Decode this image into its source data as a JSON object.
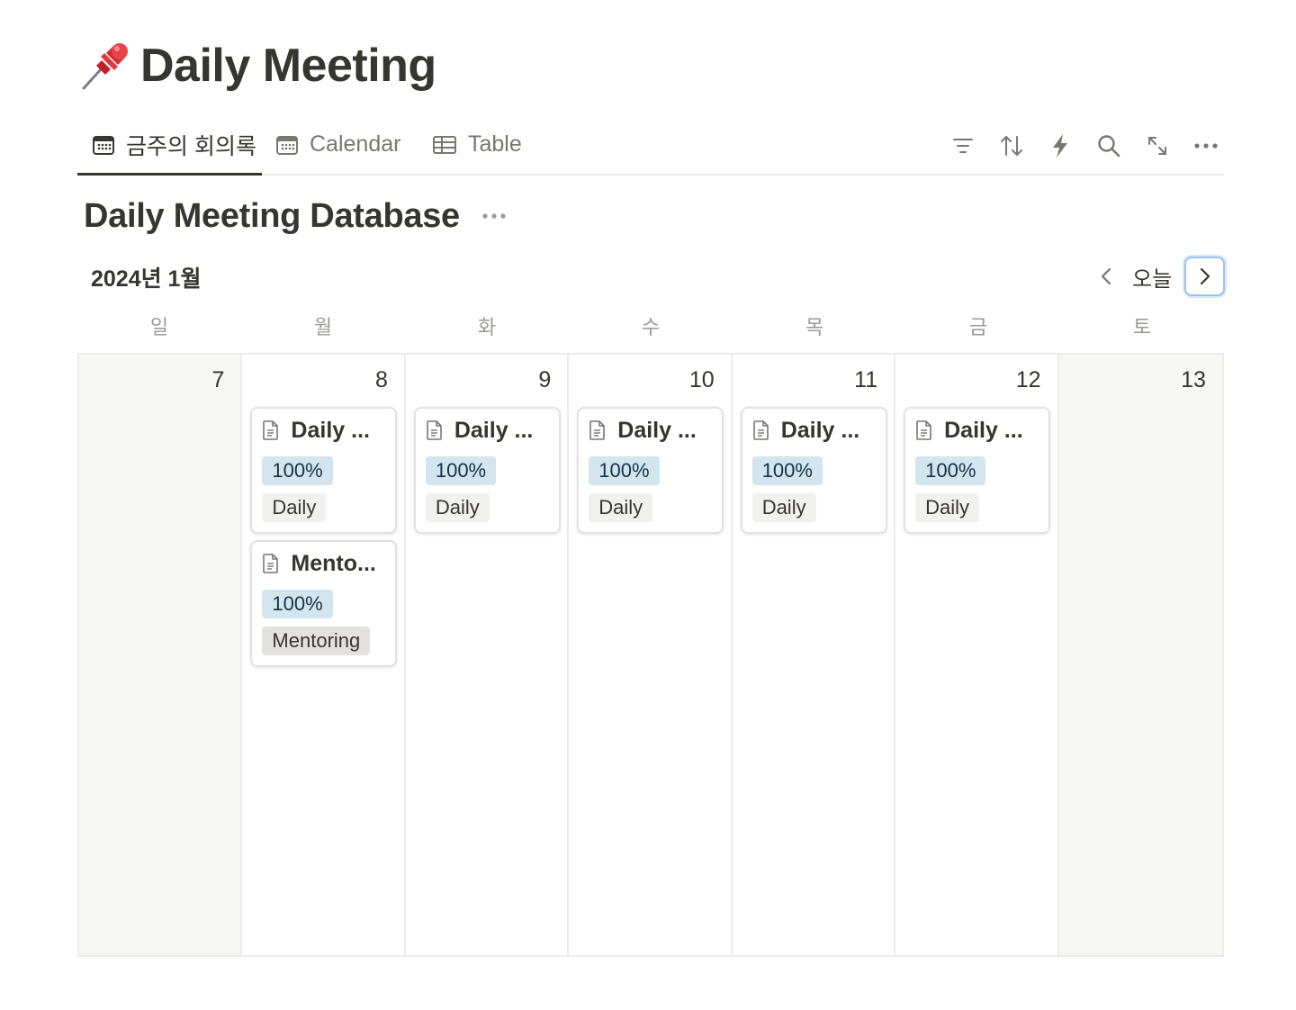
{
  "page": {
    "title": "Daily Meeting",
    "icon": "pushpin-icon"
  },
  "tabs": [
    {
      "label": "금주의 회의록",
      "icon": "calendar-icon",
      "active": true
    },
    {
      "label": "Calendar",
      "icon": "calendar-icon",
      "active": false
    },
    {
      "label": "Table",
      "icon": "table-icon",
      "active": false
    }
  ],
  "toolbar": [
    "filter-icon",
    "sort-icon",
    "automation-icon",
    "search-icon",
    "expand-icon",
    "more-icon"
  ],
  "database": {
    "title": "Daily Meeting Database"
  },
  "calendar": {
    "month_label": "2024년 1월",
    "today_label": "오늘",
    "weekdays": [
      "일",
      "월",
      "화",
      "수",
      "목",
      "금",
      "토"
    ],
    "days": [
      {
        "num": "7",
        "weekend": true,
        "cards": []
      },
      {
        "num": "8",
        "weekend": false,
        "cards": [
          {
            "title": "Daily ...",
            "progress": "100%",
            "tag": "Daily"
          },
          {
            "title": "Mento...",
            "progress": "100%",
            "tag": "Mentoring"
          }
        ]
      },
      {
        "num": "9",
        "weekend": false,
        "cards": [
          {
            "title": "Daily ...",
            "progress": "100%",
            "tag": "Daily"
          }
        ]
      },
      {
        "num": "10",
        "weekend": false,
        "cards": [
          {
            "title": "Daily ...",
            "progress": "100%",
            "tag": "Daily"
          }
        ]
      },
      {
        "num": "11",
        "weekend": false,
        "cards": [
          {
            "title": "Daily ...",
            "progress": "100%",
            "tag": "Daily"
          }
        ]
      },
      {
        "num": "12",
        "weekend": false,
        "cards": [
          {
            "title": "Daily ...",
            "progress": "100%",
            "tag": "Daily"
          }
        ]
      },
      {
        "num": "13",
        "weekend": true,
        "cards": []
      }
    ]
  },
  "colors": {
    "text": "#37352f",
    "muted": "#787774",
    "progress_bg": "#d3e5ef",
    "tag_bg": "#f1f1ef",
    "weekend_bg": "#f7f7f5",
    "focus": "#9cc3ea"
  }
}
